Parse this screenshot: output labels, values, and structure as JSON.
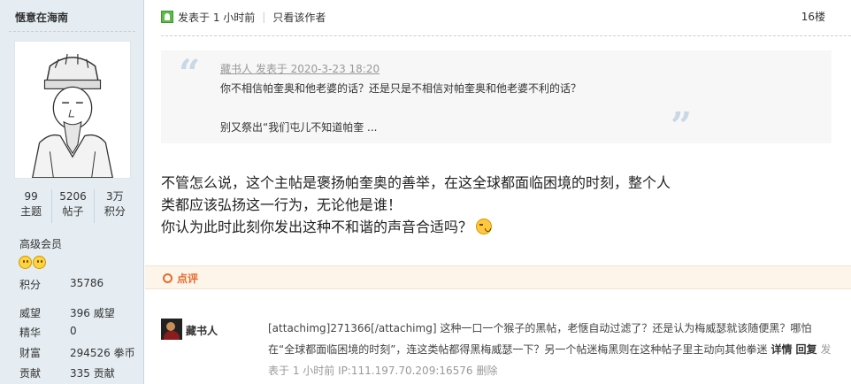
{
  "sidebar": {
    "username": "惬意在海南",
    "stats": [
      {
        "value": "99",
        "label": "主题"
      },
      {
        "value": "5206",
        "label": "帖子"
      },
      {
        "value": "3万",
        "label": "积分"
      }
    ],
    "rank": "高级会员",
    "info": [
      {
        "key": "积分",
        "value": "35786"
      },
      {
        "key": "威望",
        "value": "396 威望"
      },
      {
        "key": "精华",
        "value": "0"
      },
      {
        "key": "财富",
        "value": "294526 拳币"
      },
      {
        "key": "贡献",
        "value": "335 贡献"
      }
    ]
  },
  "post": {
    "posted": "发表于 1 小时前",
    "sep": "|",
    "only_author": "只看该作者",
    "floor": "16楼",
    "quote": {
      "open_mark": "“",
      "close_mark": "”",
      "author": "藏书人 发表于 2020-3-23 18:20",
      "line1": "你不相信帕奎奥和他老婆的话？还是只是不相信对帕奎奥和他老婆不利的话？",
      "line2": "别又祭出“我们屯儿不知道帕奎 ..."
    },
    "body_line1": "不管怎么说，这个主帖是褒扬帕奎奥的善举，在这全球都面临困境的时刻，整个人类都应该弘扬这一行为，无论他是谁！",
    "body_line2": "你认为此时此刻你发出这种不和谐的声音合适吗？"
  },
  "comment_bar": {
    "label": "点评"
  },
  "comment": {
    "author": "藏书人",
    "text": "[attachimg]271366[/attachimg] 这种一口一个猴子的黑帖，老惬自动过滤了？还是认为梅威瑟就该随便黑？哪怕在“全球都面临困境的时刻”，连这类帖都得黑梅威瑟一下？另一个帖迷梅黑则在这种帖子里主动向其他拳迷",
    "detail": "详情",
    "reply": "回复",
    "time": "发表于 1 小时前 IP:111.197.70.209:16576",
    "delete": "删除"
  }
}
